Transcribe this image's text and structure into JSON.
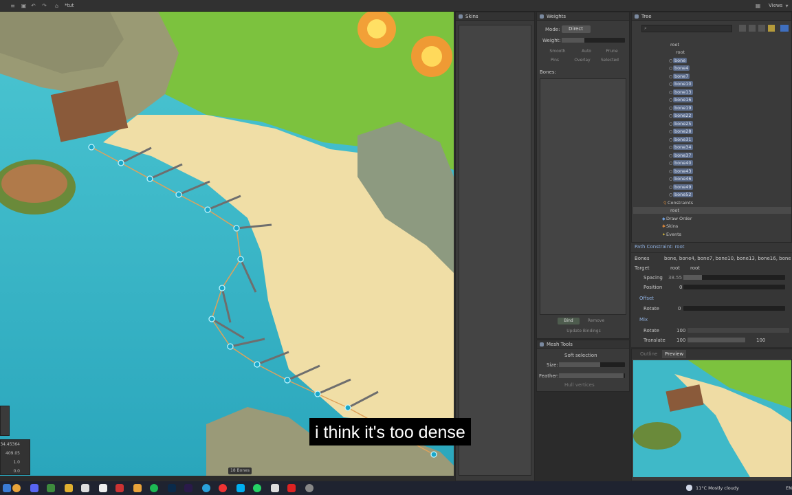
{
  "titlebar": {
    "doc_name": "*tut",
    "views_label": "Views"
  },
  "viewport": {
    "bones_badge": "18 Bones",
    "coords": [
      "34.45364",
      "409.05",
      "1.0",
      "0.0"
    ]
  },
  "skins": {
    "title": "Skins"
  },
  "weights": {
    "title": "Weights",
    "mode_label": "Mode:",
    "mode_value": "Direct",
    "weight_label": "Weight:",
    "smooth": "Smooth",
    "auto": "Auto",
    "prune": "Prune",
    "pins": "Pins",
    "overlay": "Overlay",
    "selected": "Selected",
    "bones_label": "Bones:",
    "bind": "Bind",
    "remove": "Remove",
    "update_bindings": "Update Bindings"
  },
  "mesh_tools": {
    "title": "Mesh Tools",
    "soft_selection": "Soft selection",
    "size_label": "Size:",
    "feather_label": "Feather:",
    "hull_vertices": "Hull vertices"
  },
  "tree": {
    "title": "Tree",
    "items": [
      "root",
      "root",
      "bone",
      "bone4",
      "bone7",
      "bone10",
      "bone13",
      "bone16",
      "bone19",
      "bone22",
      "bone25",
      "bone28",
      "bone31",
      "bone34",
      "bone37",
      "bone40",
      "bone43",
      "bone46",
      "bone49",
      "bone52",
      "Constraints",
      "root",
      "Draw Order",
      "Skins",
      "Events"
    ]
  },
  "props": {
    "header": "Path Constraint: root",
    "bones_label": "Bones",
    "bones_value": "bone, bone4, bone7, bone10, bone13, bone16, bone19, bo",
    "target_label": "Target",
    "target_a": "root",
    "target_b": "root",
    "spacing_label": "Spacing",
    "spacing_value": "38.55",
    "position_label": "Position",
    "position_value": "0",
    "offset_label": "Offset",
    "rotate_label": "Rotate",
    "rotate_value": "0",
    "mix_label": "Mix",
    "mix_rotate_label": "Rotate",
    "mix_rotate_value": "100",
    "mix_translate_label": "Translate",
    "mix_translate_value": "100",
    "mix_translate_value2": "100"
  },
  "preview": {
    "outline_tab": "Outline",
    "preview_tab": "Preview"
  },
  "taskbar": {
    "weather": "11°C  Mostly cloudy",
    "lang": "EN"
  },
  "subtitle": "i think it's too dense"
}
